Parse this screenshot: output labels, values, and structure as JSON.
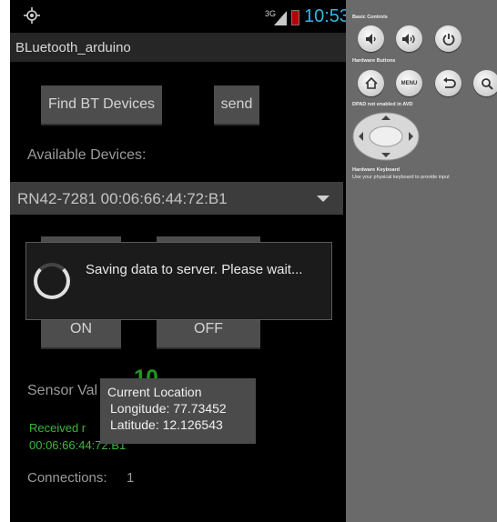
{
  "statusbar": {
    "network": "3G",
    "time": "10:53"
  },
  "app": {
    "title": "BLuetooth_arduino"
  },
  "buttons": {
    "find": "Find BT Devices",
    "send": "send",
    "on": "ON",
    "off": "OFF"
  },
  "available_label": "Available Devices:",
  "spinner": {
    "selected": "RN42-7281 00:06:66:44:72:B1"
  },
  "dialog": {
    "message": "Saving data to server. Please wait..."
  },
  "sensor": {
    "label": "Sensor Val",
    "value": "10"
  },
  "received": {
    "line1": "Received r",
    "line2": "00:06:66:44:72:B1"
  },
  "connections": {
    "label": "Connections:",
    "value": "1"
  },
  "tooltip": {
    "title": "Current Location",
    "longitude": "Longitude: 77.73452",
    "latitude": "Latitude: 12.126543"
  },
  "panel": {
    "basic_controls": "Basic Controls",
    "hardware_buttons": "Hardware Buttons",
    "menu_label": "MENU",
    "dpad_label": "DPAD not enabled in AVD",
    "keyboard_label": "Hardware Keyboard",
    "keyboard_hint": "Use your physical keyboard to provide input"
  },
  "colors": {
    "time": "#33b5e5",
    "received_text": "#3cb83c",
    "battery": "#b00000"
  }
}
